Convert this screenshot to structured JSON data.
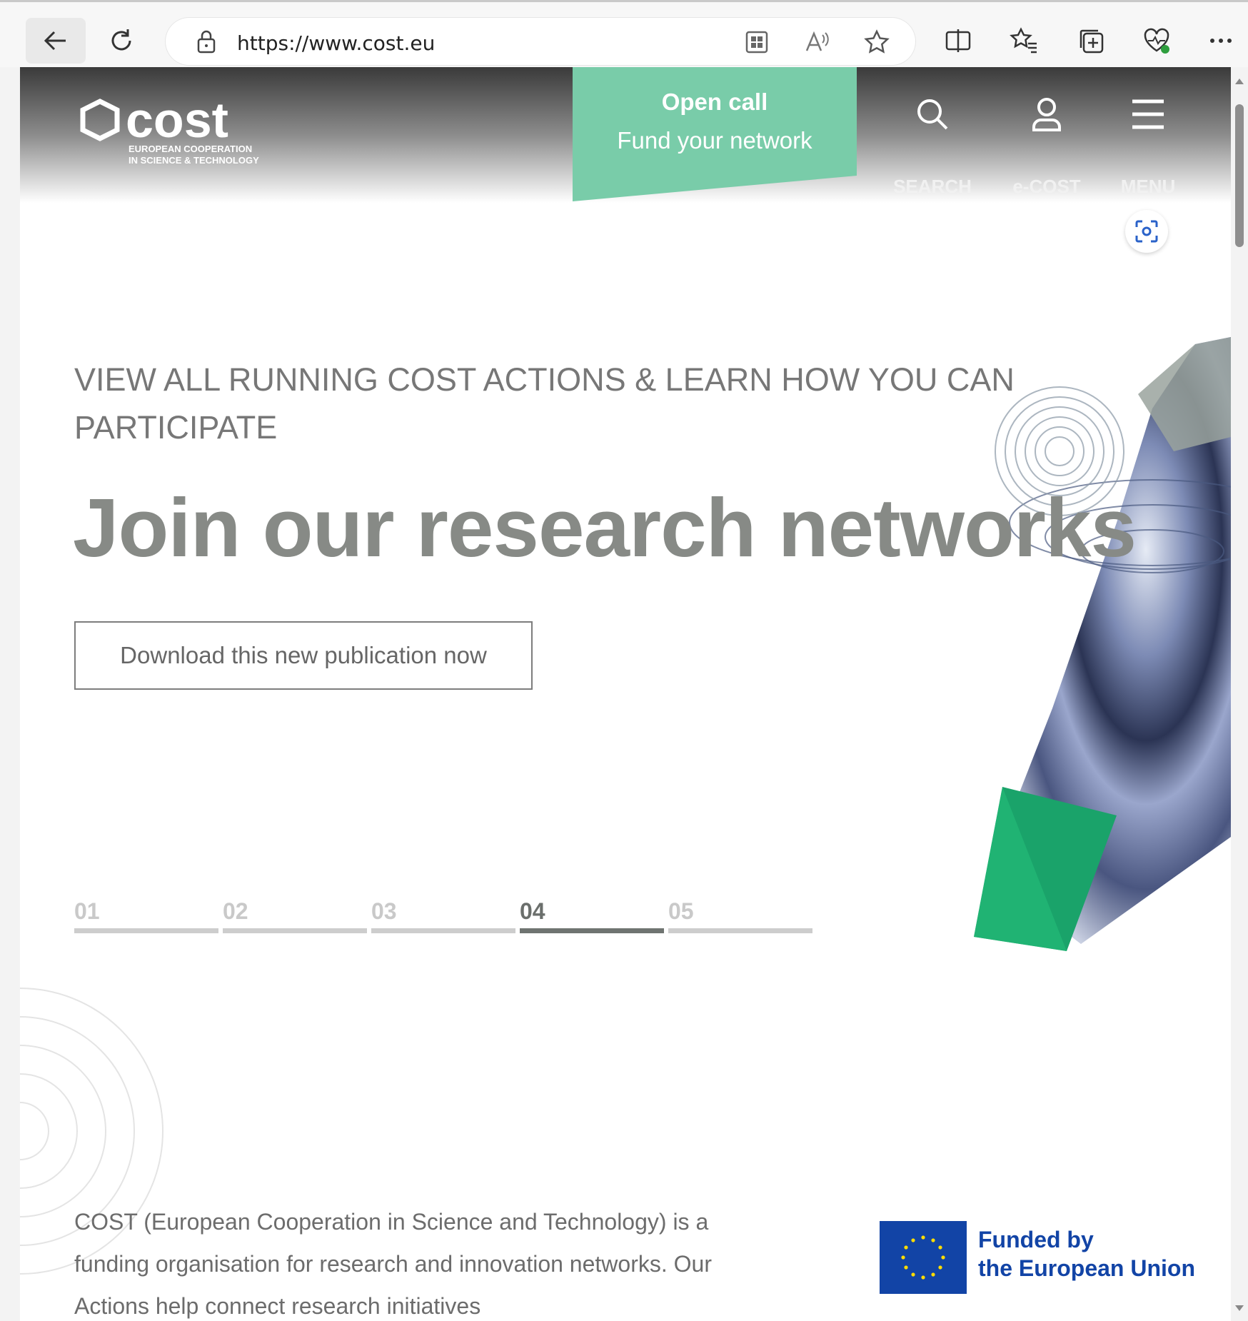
{
  "browser": {
    "url": "https://www.cost.eu",
    "icons": [
      "back-icon",
      "reload-icon",
      "lock-icon",
      "app-available-icon",
      "read-aloud-icon",
      "favorite-star-icon",
      "split-screen-icon",
      "favorites-icon",
      "collections-icon",
      "browser-essentials-icon",
      "more-icon"
    ]
  },
  "header": {
    "logo_text": "cost",
    "logo_sub_1": "EUROPEAN COOPERATION",
    "logo_sub_2": "IN SCIENCE & TECHNOLOGY",
    "open_call_title": "Open call",
    "open_call_sub": "Fund your network",
    "search_label": "SEARCH",
    "ecost_label": "e-COST",
    "menu_label": "MENU",
    "accent_color": "#79cca9"
  },
  "hero": {
    "kicker": "VIEW ALL RUNNING COST ACTIONS & LEARN HOW YOU CAN PARTICIPATE",
    "headline": "Join our research networks",
    "cta": "Download this new publication now",
    "slides": [
      "01",
      "02",
      "03",
      "04",
      "05"
    ],
    "active_slide": "04"
  },
  "about": {
    "text": "COST (European Cooperation in Science and Technology) is a funding organisation for research and innovation networks. Our Actions help connect research initiatives"
  },
  "eu_badge": {
    "line1": "Funded by",
    "line2": "the European Union",
    "color": "#1244a6"
  }
}
